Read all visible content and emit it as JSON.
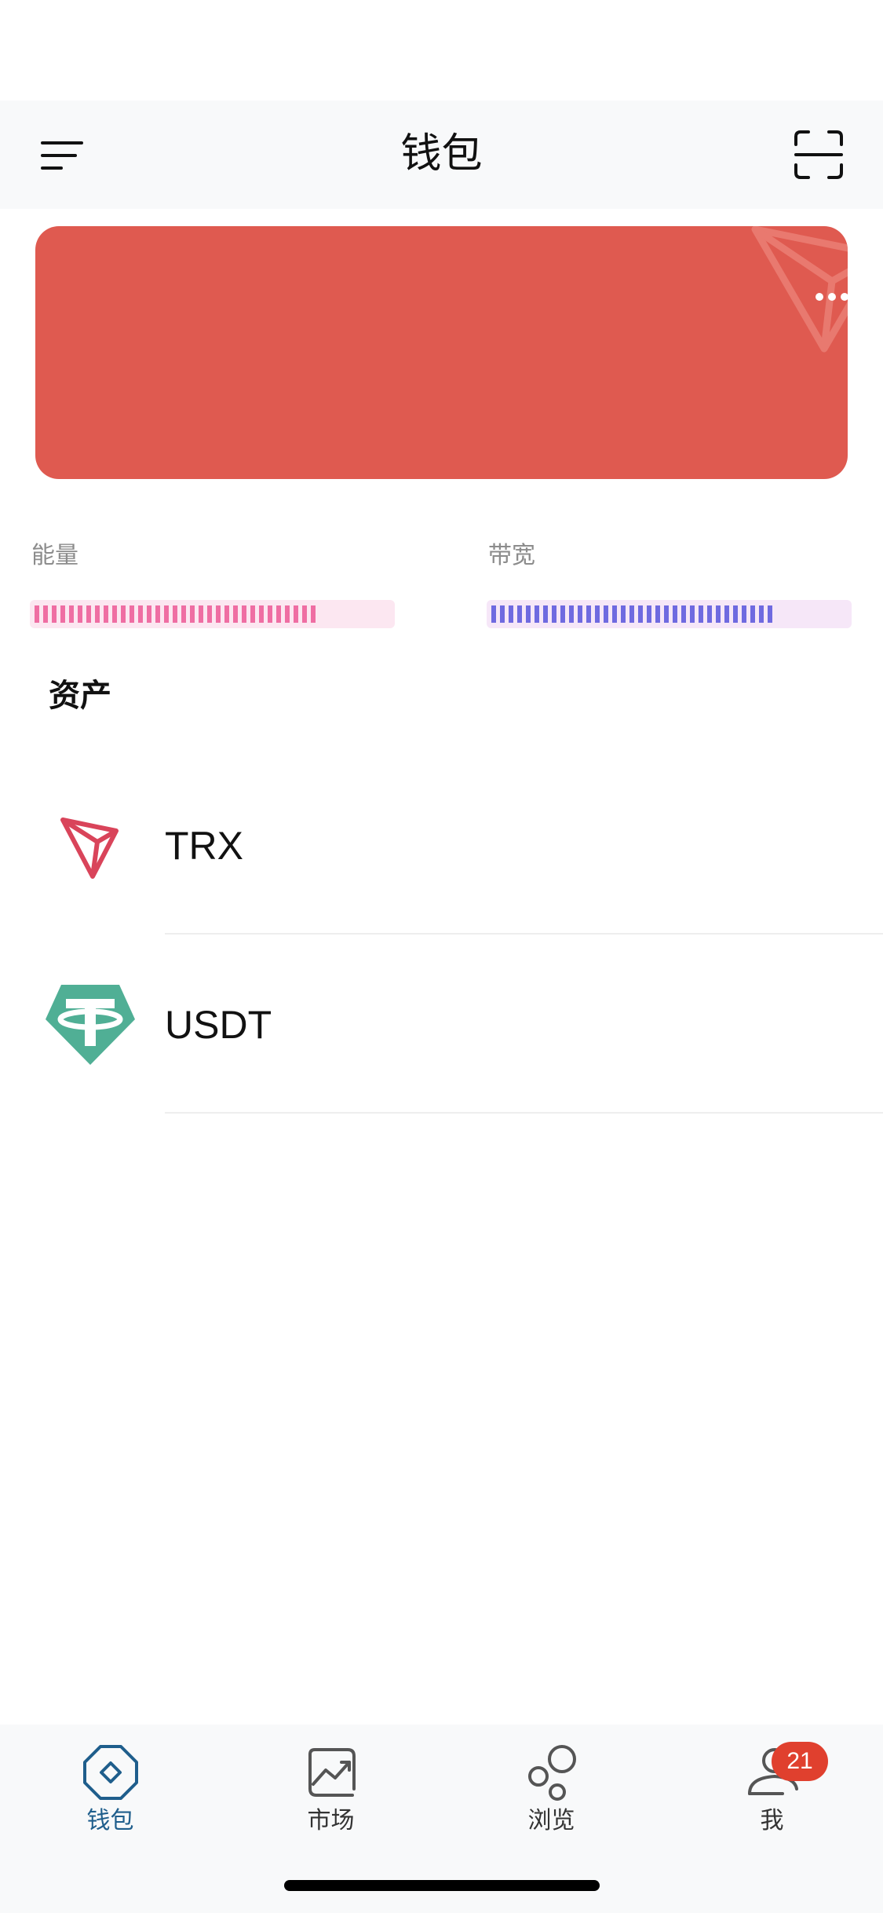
{
  "header": {
    "title": "钱包",
    "menu_icon": "menu-icon",
    "scan_icon": "scan-icon"
  },
  "wallet_card": {
    "background_color": "#df5a50",
    "watermark_icon": "tron-logo-icon",
    "more_icon": "more-horizontal-icon"
  },
  "resources": {
    "energy": {
      "label": "能量",
      "fill_fraction": 0.8,
      "color": "#ef6ea3"
    },
    "bandwidth": {
      "label": "带宽",
      "fill_fraction": 0.8,
      "color": "#6f6ae0"
    }
  },
  "assets": {
    "title": "资产",
    "items": [
      {
        "symbol": "TRX",
        "icon": "trx-icon"
      },
      {
        "symbol": "USDT",
        "icon": "usdt-icon"
      }
    ]
  },
  "tabbar": {
    "tabs": [
      {
        "label": "钱包",
        "icon": "wallet-tab-icon",
        "active": true
      },
      {
        "label": "市场",
        "icon": "market-tab-icon"
      },
      {
        "label": "浏览",
        "icon": "browse-tab-icon"
      },
      {
        "label": "我",
        "icon": "profile-tab-icon",
        "badge": "21"
      }
    ],
    "active_color": "#1f5e8c",
    "badge_color": "#e0402e"
  }
}
